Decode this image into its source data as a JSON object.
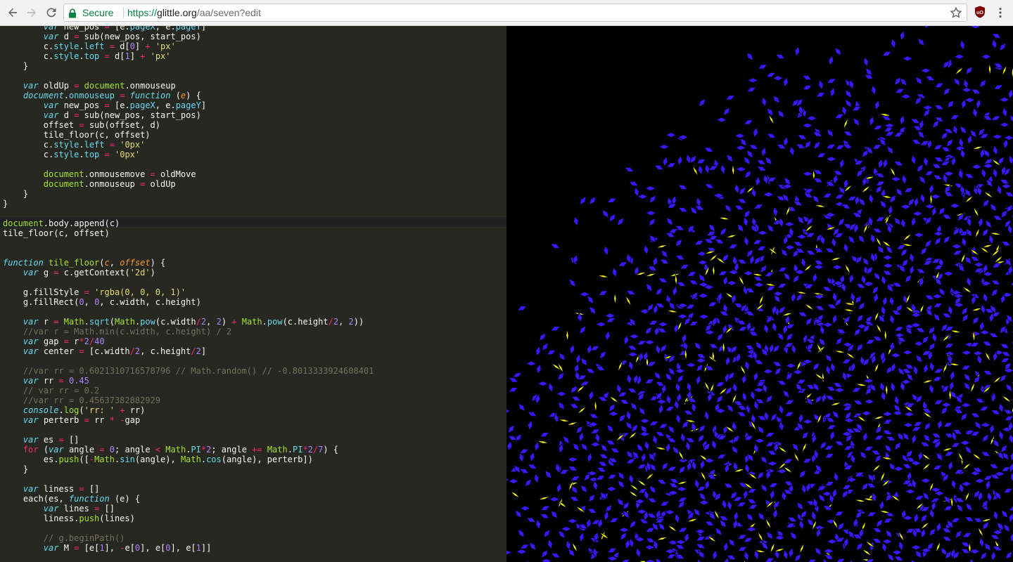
{
  "browser": {
    "secure_label": "Secure",
    "url_scheme": "https://",
    "url_host": "glittle.org",
    "url_path": "/aa/seven?edit",
    "extension_icon": "ublock-origin-icon"
  },
  "editor": {
    "language": "javascript",
    "highlighted_line": 21
  },
  "canvas": {
    "description_colors": {
      "background": "#000000",
      "tile_primary": "#3a18ff",
      "tile_highlight": "#ffff00",
      "tile_stroke": "#000000"
    }
  },
  "colors": {
    "secure_green": "#0b8043",
    "editor_bg": "#272822"
  }
}
